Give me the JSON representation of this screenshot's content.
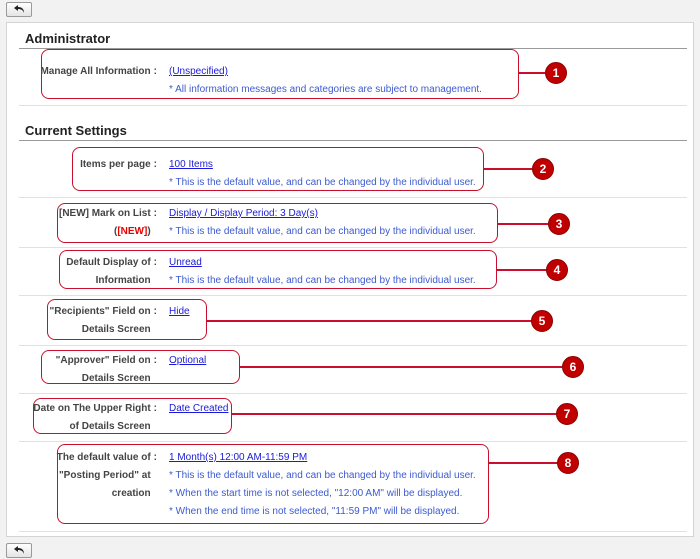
{
  "toolbar": {
    "back_icon": "back-arrow-icon"
  },
  "sections": {
    "administrator": "Administrator",
    "current_settings": "Current Settings"
  },
  "rows": {
    "manage_all": {
      "label": "Manage All Information",
      "value": "(Unspecified)",
      "notes": [
        "* All information messages and categories are subject to management."
      ]
    },
    "items_per_page": {
      "label": "Items per page",
      "value": "100 Items",
      "notes": [
        "* This is the default value, and can be changed by the individual user."
      ]
    },
    "new_mark": {
      "label_line1": "[NEW] Mark on List",
      "label_line2_open": "(",
      "label_line2_mark": "[NEW]",
      "label_line2_close": ")",
      "value": "Display / Display Period: 3 Day(s)",
      "notes": [
        "* This is the default value, and can be changed by the individual user."
      ]
    },
    "default_display": {
      "label_line1": "Default Display of",
      "label_line2": "Information",
      "value": "Unread",
      "notes": [
        "* This is the default value, and can be changed by the individual user."
      ]
    },
    "recipients": {
      "label_line1": "\"Recipients\" Field on",
      "label_line2": "Details Screen",
      "value": "Hide"
    },
    "approver": {
      "label_line1": "\"Approver\" Field on",
      "label_line2": "Details Screen",
      "value": "Optional"
    },
    "date_upper_right": {
      "label_line1": "Date on The Upper Right",
      "label_line2": "of Details Screen",
      "value": "Date Created"
    },
    "posting_period": {
      "label_line1": "The default value of",
      "label_line2": "\"Posting Period\" at",
      "label_line3": "creation",
      "value": "1 Month(s) 12:00 AM-11:59 PM",
      "notes": [
        "* This is the default value, and can be changed by the individual user.",
        "* When the start time is not selected, \"12:00 AM\" will be displayed.",
        "* When the end time is not selected, \"11:59 PM\" will be displayed."
      ]
    }
  },
  "callouts": [
    "1",
    "2",
    "3",
    "4",
    "5",
    "6",
    "7",
    "8"
  ],
  "colors": {
    "accent": "#c8102e",
    "link": "#1a1ad8",
    "note": "#3c5bd0",
    "new_mark": "#e60000"
  }
}
